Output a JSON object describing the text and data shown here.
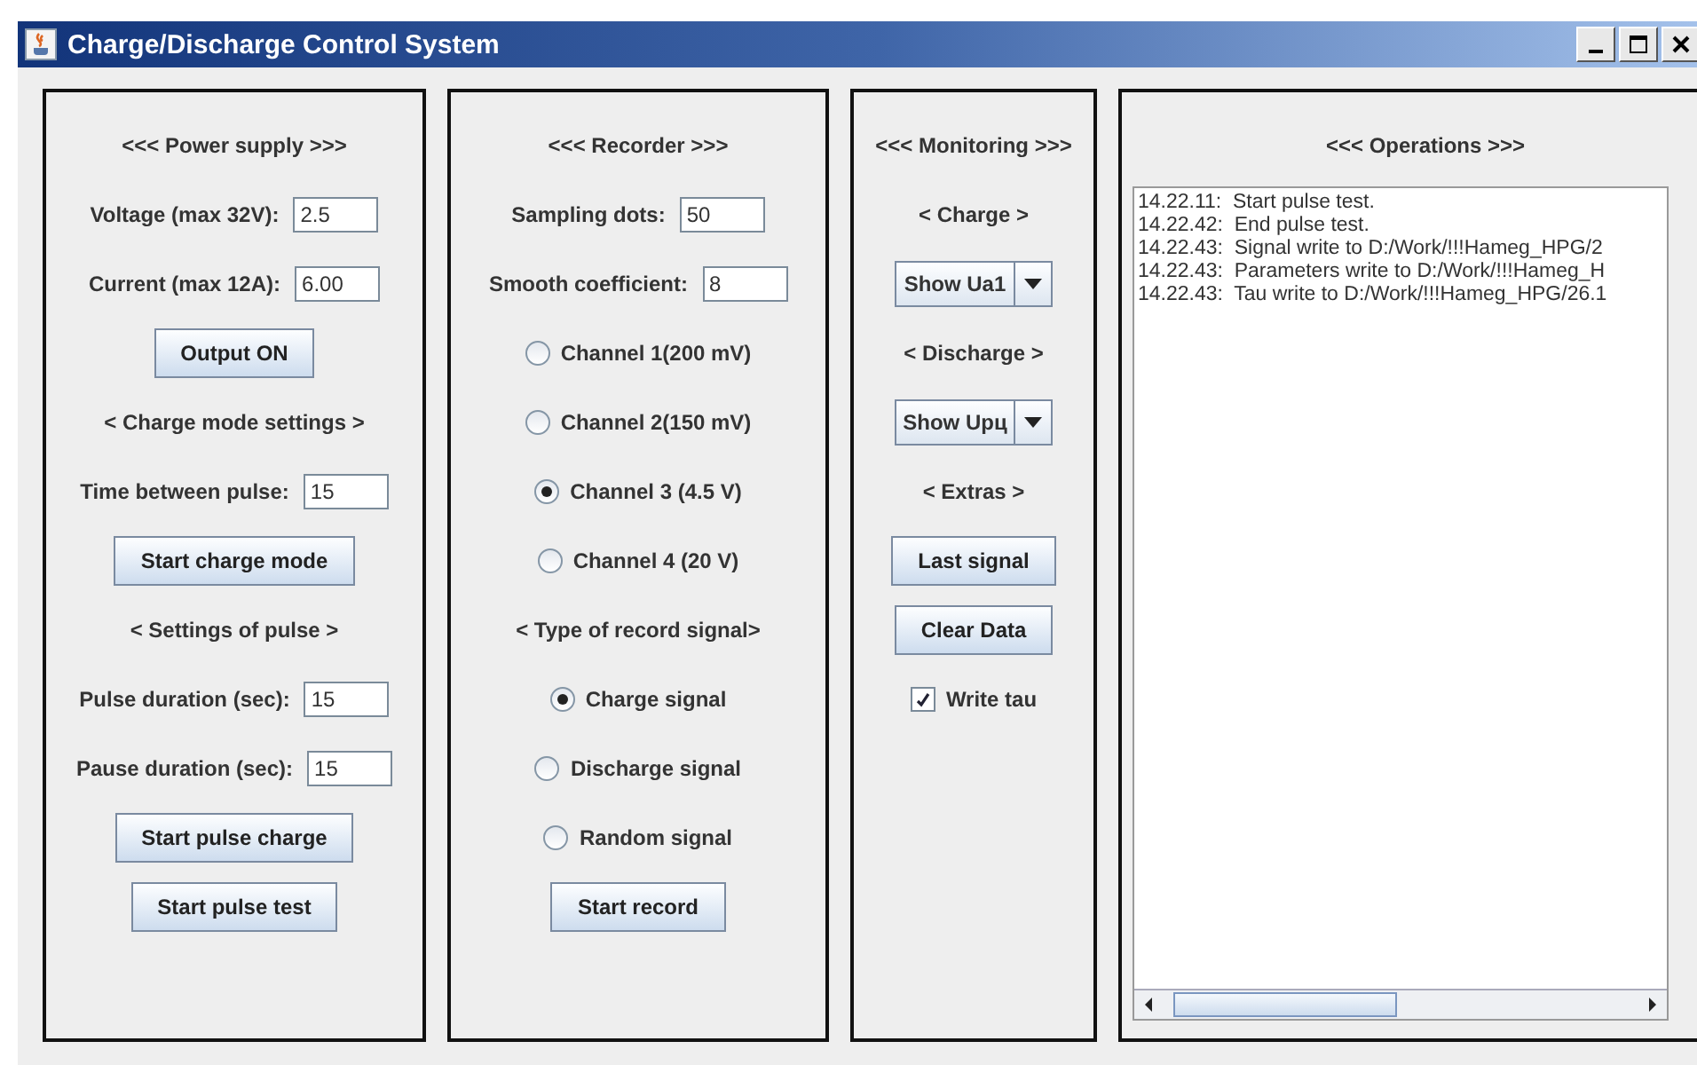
{
  "window": {
    "title": "Charge/Discharge Control System"
  },
  "panels": [
    {
      "items": [
        {
          "kind": "heading",
          "text": "<<< Power supply >>>"
        },
        {
          "kind": "field",
          "label": "Voltage (max 32V):",
          "value": "2.5"
        },
        {
          "kind": "field",
          "label": "Current (max 12A):",
          "value": "6.00"
        },
        {
          "kind": "button",
          "text": "Output ON"
        },
        {
          "kind": "heading",
          "text": "< Charge mode settings >"
        },
        {
          "kind": "field",
          "label": "Time between pulse:",
          "value": "15"
        },
        {
          "kind": "button",
          "text": "Start charge mode"
        },
        {
          "kind": "heading",
          "text": "< Settings of pulse >"
        },
        {
          "kind": "field",
          "label": "Pulse duration (sec):",
          "value": "15"
        },
        {
          "kind": "field",
          "label": "Pause duration (sec):",
          "value": "15"
        },
        {
          "kind": "button",
          "text": "Start pulse charge"
        },
        {
          "kind": "button",
          "text": "Start pulse test"
        }
      ]
    },
    {
      "items": [
        {
          "kind": "heading",
          "text": "<<< Recorder >>>"
        },
        {
          "kind": "field",
          "label": "Sampling dots:",
          "value": "50"
        },
        {
          "kind": "field",
          "label": "Smooth coefficient:",
          "value": "8"
        },
        {
          "kind": "radio",
          "text": "Channel 1(200 mV)",
          "selected": false
        },
        {
          "kind": "radio",
          "text": "Channel 2(150 mV)",
          "selected": false
        },
        {
          "kind": "radio",
          "text": "Channel 3 (4.5 V)",
          "selected": true
        },
        {
          "kind": "radio",
          "text": "Channel 4 (20 V)",
          "selected": false
        },
        {
          "kind": "heading",
          "text": "< Type of record signal>"
        },
        {
          "kind": "radio",
          "text": "Charge signal",
          "selected": true
        },
        {
          "kind": "radio",
          "text": "Discharge signal",
          "selected": false
        },
        {
          "kind": "radio",
          "text": "Random signal",
          "selected": false
        },
        {
          "kind": "button",
          "text": "Start record"
        }
      ]
    },
    {
      "items": [
        {
          "kind": "heading",
          "text": "<<< Monitoring >>>"
        },
        {
          "kind": "heading",
          "text": "< Charge >"
        },
        {
          "kind": "combo",
          "value": "Show Ua1"
        },
        {
          "kind": "heading",
          "text": "< Discharge >"
        },
        {
          "kind": "combo",
          "value": "Show Upц"
        },
        {
          "kind": "heading",
          "text": "< Extras >"
        },
        {
          "kind": "button",
          "text": "Last signal"
        },
        {
          "kind": "button",
          "text": "Clear Data"
        },
        {
          "kind": "checkbox",
          "text": "Write tau",
          "checked": true
        }
      ]
    }
  ],
  "operations": {
    "title": "<<< Operations >>>",
    "log": [
      "14.22.11:  Start pulse test.",
      "14.22.42:  End pulse test.",
      "14.22.43:  Signal write to D:/Work/!!!Hameg_HPG/2",
      "14.22.43:  Parameters write to D:/Work/!!!Hameg_H",
      "14.22.43:  Tau write to D:/Work/!!!Hameg_HPG/26.1"
    ]
  }
}
